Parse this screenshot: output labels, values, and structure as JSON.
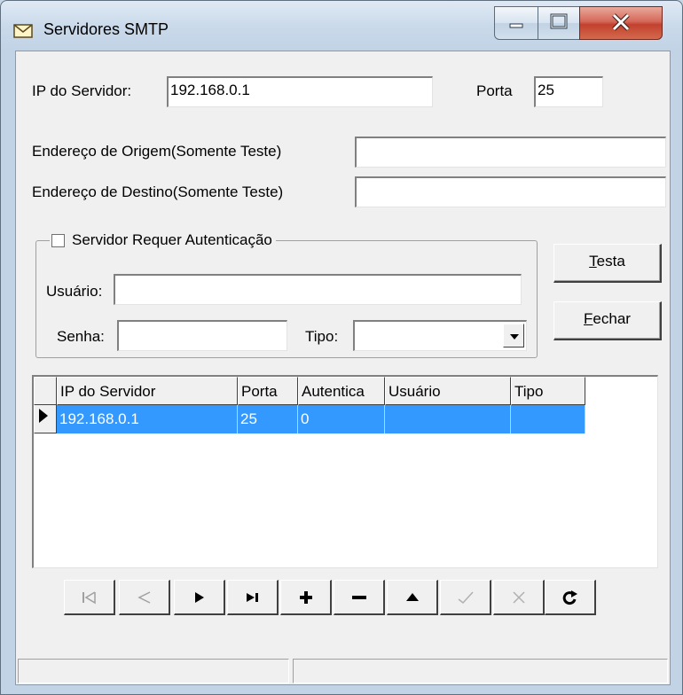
{
  "window": {
    "title": "Servidores SMTP",
    "title_icon": "envelope-icon"
  },
  "form": {
    "ip_label": "IP do Servidor:",
    "ip_value": "192.168.0.1",
    "porta_label": "Porta",
    "porta_value": "25",
    "origem_label": "Endereço de Origem(Somente Teste)",
    "origem_value": "",
    "destino_label": "Endereço de Destino(Somente Teste)",
    "destino_value": "",
    "auth_group_label": "Servidor Requer Autenticação",
    "auth_checked": false,
    "usuario_label": "Usuário:",
    "usuario_value": "",
    "senha_label": "Senha:",
    "senha_value": "",
    "tipo_label": "Tipo:",
    "tipo_value": ""
  },
  "buttons": {
    "testa_label": "Testa",
    "testa_access_key": "T",
    "fechar_label": "Fechar",
    "fechar_access_key": "F"
  },
  "grid": {
    "columns": [
      "IP do Servidor",
      "Porta",
      "Autentica",
      "Usuário",
      "Tipo"
    ],
    "rows": [
      [
        "192.168.0.1",
        "25",
        "0",
        "",
        ""
      ]
    ],
    "selected_row": 0
  },
  "navigator": {
    "buttons": [
      {
        "name": "first",
        "icon": "first-record-icon",
        "enabled": false
      },
      {
        "name": "prior",
        "icon": "prior-record-icon",
        "enabled": false
      },
      {
        "name": "next",
        "icon": "next-record-icon",
        "enabled": true
      },
      {
        "name": "last",
        "icon": "last-record-icon",
        "enabled": true
      },
      {
        "name": "insert",
        "icon": "plus-icon",
        "enabled": true
      },
      {
        "name": "delete",
        "icon": "minus-icon",
        "enabled": true
      },
      {
        "name": "edit",
        "icon": "up-triangle-icon",
        "enabled": true
      },
      {
        "name": "post",
        "icon": "checkmark-icon",
        "enabled": false
      },
      {
        "name": "cancel",
        "icon": "x-icon",
        "enabled": false
      },
      {
        "name": "refresh",
        "icon": "refresh-icon",
        "enabled": true
      }
    ]
  },
  "statusbar": {
    "panel1": "",
    "panel2": ""
  },
  "colors": {
    "selection": "#3399ff",
    "close_button": "#c2412f"
  }
}
